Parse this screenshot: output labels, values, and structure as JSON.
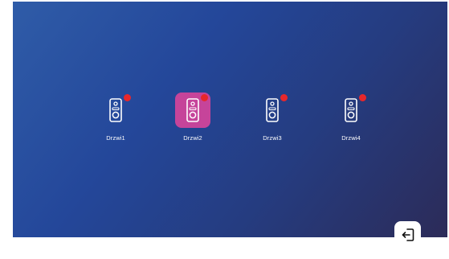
{
  "doors": [
    {
      "label": "Drzwi1",
      "selected": false,
      "status": "red-dot",
      "icon": "doorbell-icon"
    },
    {
      "label": "Drzwi2",
      "selected": true,
      "status": "red-dot",
      "icon": "doorbell-icon"
    },
    {
      "label": "Drzwi3",
      "selected": false,
      "status": "red-dot",
      "icon": "doorbell-icon"
    },
    {
      "label": "Drzwi4",
      "selected": false,
      "status": "red-dot",
      "icon": "doorbell-icon"
    }
  ],
  "exit": {
    "icon": "exit-icon"
  },
  "colors": {
    "selected_tile": "#c6449a",
    "status_dot": "#e8272b",
    "background_start": "#2f5ca8",
    "background_end": "#2c2b58"
  }
}
